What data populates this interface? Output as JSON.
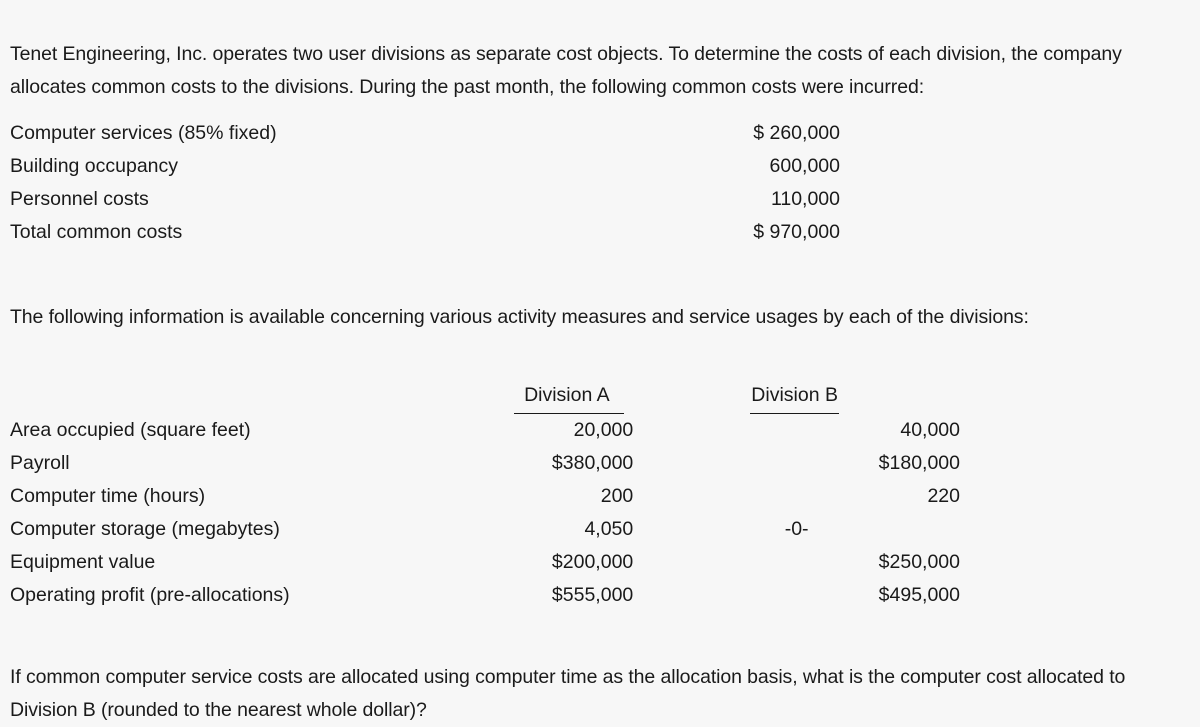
{
  "document": {
    "intro_paragraph": "Tenet Engineering, Inc. operates two user divisions as separate cost objects. To determine the costs of each division, the company allocates common costs to the divisions. During the past month, the following common costs were incurred:",
    "common_costs": {
      "rows": [
        {
          "label": "Computer services (85% fixed)",
          "amount": "$ 260,000"
        },
        {
          "label": "Building occupancy",
          "amount": "600,000"
        },
        {
          "label": "Personnel costs",
          "amount": "110,000"
        },
        {
          "label": "Total common costs",
          "amount": "$ 970,000"
        }
      ]
    },
    "mid_paragraph": "The following information is available concerning various activity measures and service usages by each of the divisions:",
    "division_table": {
      "headers": {
        "measure": "",
        "division_a": "Division A",
        "division_b": "Division B"
      },
      "rows": [
        {
          "measure": "Area occupied (square feet)",
          "division_a": "20,000",
          "division_b": "40,000"
        },
        {
          "measure": "Payroll",
          "division_a": "$380,000",
          "division_b": "$180,000"
        },
        {
          "measure": "Computer time (hours)",
          "division_a": "200",
          "division_b": "220"
        },
        {
          "measure": "Computer storage (megabytes)",
          "division_a": "4,050",
          "division_b": "-0-"
        },
        {
          "measure": "Equipment value",
          "division_a": "$200,000",
          "division_b": "$250,000"
        },
        {
          "measure": "Operating profit (pre-allocations)",
          "division_a": "$555,000",
          "division_b": "$495,000"
        }
      ]
    },
    "question_paragraph": "If common computer service costs are allocated using computer time as the allocation basis, what is the computer cost allocated to Division B (rounded to the nearest whole dollar)?"
  },
  "style": {
    "background_color": "#f7f7f7",
    "text_color": "#1a1a1a"
  }
}
